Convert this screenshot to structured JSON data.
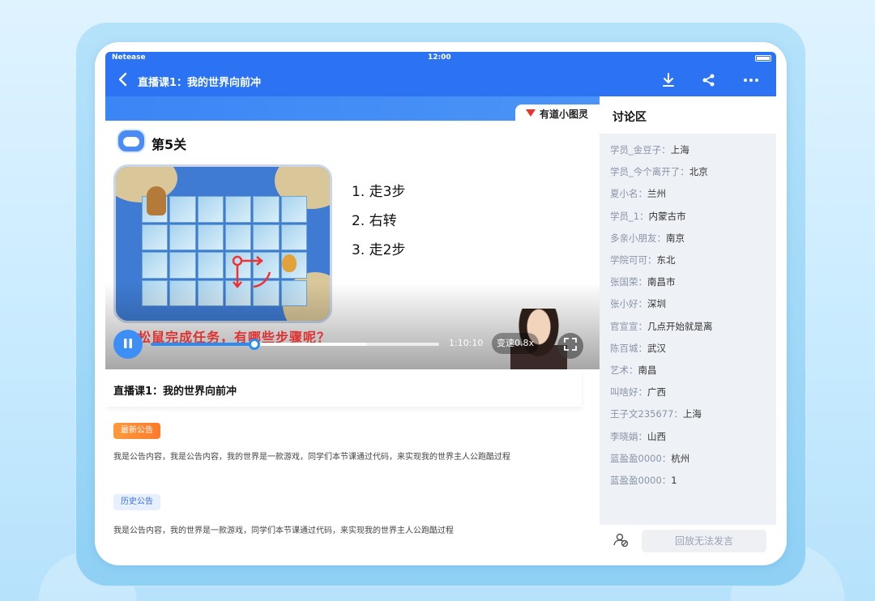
{
  "status_bar": {
    "carrier": "Netease",
    "time": "12:00"
  },
  "nav": {
    "title": "直播课1：我的世界向前冲",
    "icons": [
      "back-icon",
      "download-icon",
      "share-icon",
      "more-icon"
    ]
  },
  "video": {
    "brand": "有道小图灵",
    "level_title": "第5关",
    "steps": [
      "1. 走3步",
      "2. 右转",
      "3. 走2步"
    ],
    "subtitle": "松鼠完成任务，有哪些步骤呢？",
    "progress": 0.36,
    "buffered": 0.75,
    "duration": "1:10:10",
    "speed_label": "变速0.8x",
    "colors": {
      "accent": "#2b8cf3",
      "nav": "#2b73f3",
      "subtitle": "#e03030"
    }
  },
  "course": {
    "title": "直播课1：我的世界向前冲"
  },
  "notices": {
    "latest_label": "最新公告",
    "latest_text": "我是公告内容，我是公告内容，我的世界是一款游戏，同学们本节课通过代码，来实现我的世界主人公跑酷过程",
    "history_label": "历史公告",
    "history_text": "我是公告内容，我的世界是一款游戏，同学们本节课通过代码，来实现我的世界主人公跑酷过程"
  },
  "discussion": {
    "title": "讨论区",
    "messages": [
      {
        "user": "学员_金豆子：",
        "text": "上海"
      },
      {
        "user": "学员_今个离开了：",
        "text": "北京"
      },
      {
        "user": "夏小名：",
        "text": "兰州"
      },
      {
        "user": "学员_1：",
        "text": "内蒙古市"
      },
      {
        "user": "多亲小朋友：",
        "text": "南京"
      },
      {
        "user": "学院可可：",
        "text": "东北"
      },
      {
        "user": "张国荣：",
        "text": "南昌市"
      },
      {
        "user": "张小好：",
        "text": "深圳"
      },
      {
        "user": "官宣宣：",
        "text": "几点开始就是离"
      },
      {
        "user": "陈百城：",
        "text": "武汉"
      },
      {
        "user": "艺术：",
        "text": "南昌"
      },
      {
        "user": "叫啥好：",
        "text": "广西"
      },
      {
        "user": "王子文235677：",
        "text": "上海"
      },
      {
        "user": "李晓娟：",
        "text": "山西"
      },
      {
        "user": "蓝盈盈0000：",
        "text": "杭州"
      },
      {
        "user": "蓝盈盈0000：",
        "text": "1"
      }
    ],
    "reply_disabled": "回放无法发言"
  }
}
